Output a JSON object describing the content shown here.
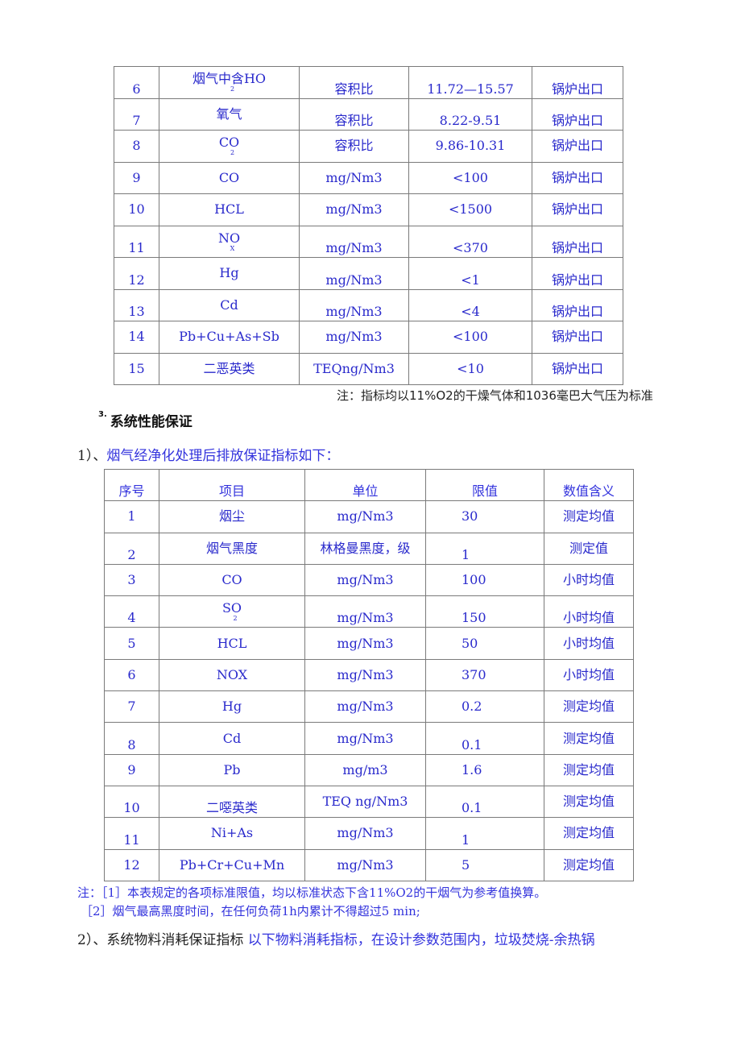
{
  "table1": {
    "rows": [
      {
        "no": "6",
        "item": "烟气中含HO",
        "item_sub": "2",
        "unit": "容积比",
        "value": "11.72—15.57",
        "location": "锅炉出口"
      },
      {
        "no": "7",
        "item": "氧气",
        "item_sub": "",
        "unit": "容积比",
        "value": "8.22-9.51",
        "location": "锅炉出口"
      },
      {
        "no": "8",
        "item": "CO",
        "item_sub": "2",
        "unit": "容积比",
        "value": "9.86-10.31",
        "location": "锅炉出口"
      },
      {
        "no": "9",
        "item": "CO",
        "item_sub": "",
        "unit": "mg/Nm3",
        "value": "<100",
        "location": "锅炉出口"
      },
      {
        "no": "10",
        "item": "HCL",
        "item_sub": "",
        "unit": "mg/Nm3",
        "value": "<1500",
        "location": "锅炉出口"
      },
      {
        "no": "11",
        "item": "NO",
        "item_sub": "X",
        "unit": "mg/Nm3",
        "value": "<370",
        "location": "锅炉出口"
      },
      {
        "no": "12",
        "item": "Hg",
        "item_sub": "",
        "unit": "mg/Nm3",
        "value": "<1",
        "location": "锅炉出口"
      },
      {
        "no": "13",
        "item": "Cd",
        "item_sub": "",
        "unit": "mg/Nm3",
        "value": "<4",
        "location": "锅炉出口"
      },
      {
        "no": "14",
        "item": "Pb+Cu+As+Sb",
        "item_sub": "",
        "unit": "mg/Nm3",
        "value": "<100",
        "location": "锅炉出口"
      },
      {
        "no": "15",
        "item": "二恶英类",
        "item_sub": "",
        "unit": "TEQng/Nm3",
        "value": "<10",
        "location": "锅炉出口"
      }
    ],
    "note": "注：指标均以11%O2的干燥气体和1036毫巴大气压为标准"
  },
  "section3": {
    "number": "3.",
    "title": "系统性能保证"
  },
  "sub1": {
    "prefix": "1）、",
    "text": "烟气经净化处理后排放保证指标如下："
  },
  "table2": {
    "headers": [
      "序号",
      "项目",
      "单位",
      "限值",
      "数值含义"
    ],
    "rows": [
      {
        "no": "1",
        "item": "烟尘",
        "item_sub": "",
        "unit": "mg/Nm3",
        "limit": "30",
        "meaning": "测定均值"
      },
      {
        "no": "2",
        "item": "烟气黑度",
        "item_sub": "",
        "unit": "林格曼黑度，级",
        "limit": "1",
        "meaning": "测定值"
      },
      {
        "no": "3",
        "item": "CO",
        "item_sub": "",
        "unit": "mg/Nm3",
        "limit": "100",
        "meaning": "小时均值"
      },
      {
        "no": "4",
        "item": "SO",
        "item_sub": "2",
        "unit": "mg/Nm3",
        "limit": "150",
        "meaning": "小时均值"
      },
      {
        "no": "5",
        "item": "HCL",
        "item_sub": "",
        "unit": "mg/Nm3",
        "limit": "50",
        "meaning": "小时均值"
      },
      {
        "no": "6",
        "item": "NOX",
        "item_sub": "",
        "unit": "mg/Nm3",
        "limit": "370",
        "meaning": "小时均值"
      },
      {
        "no": "7",
        "item": "Hg",
        "item_sub": "",
        "unit": "mg/Nm3",
        "limit": "0.2",
        "meaning": "测定均值"
      },
      {
        "no": "8",
        "item": "Cd",
        "item_sub": "",
        "unit": "mg/Nm3",
        "limit": "0.1",
        "meaning": "测定均值"
      },
      {
        "no": "9",
        "item": "Pb",
        "item_sub": "",
        "unit": "mg/m3",
        "limit": "1.6",
        "meaning": "测定均值"
      },
      {
        "no": "10",
        "item": "二噁英类",
        "item_sub": "",
        "unit": "TEQ ng/Nm3",
        "limit": "0.1",
        "meaning": "测定均值"
      },
      {
        "no": "11",
        "item": "Ni+As",
        "item_sub": "",
        "unit": "mg/Nm3",
        "limit": "1",
        "meaning": "测定均值"
      },
      {
        "no": "12",
        "item": "Pb+Cr+Cu+Mn",
        "item_sub": "",
        "unit": "mg/Nm3",
        "limit": "5",
        "meaning": "测定均值"
      }
    ],
    "notes": [
      "注：［1］本表规定的各项标准限值，均以标准状态下含11%O2的干烟气为参考值换算。",
      "［2］烟气最高黑度时间，在任何负荷1h内累计不得超过5 min;"
    ]
  },
  "sub2": {
    "prefix": "2）、系统物料消耗保证指标",
    "text": "以下物料消耗指标，在设计参数范围内，垃圾焚烧-余热锅"
  }
}
